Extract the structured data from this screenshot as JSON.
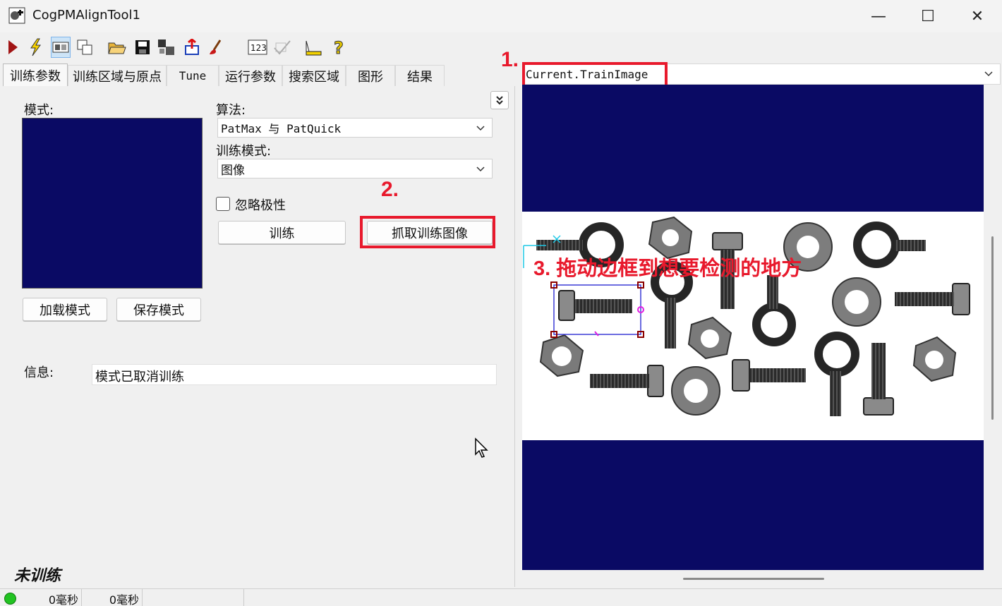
{
  "window": {
    "title": "CogPMAlignTool1"
  },
  "window_controls": {
    "minimize": "—",
    "maximize": "☐",
    "close": "✕"
  },
  "toolbar": {
    "items": [
      "run-icon",
      "lightning-icon",
      "display-icon",
      "copy-window-icon",
      "open-folder-icon",
      "save-icon",
      "settings-icon",
      "import-icon",
      "clear-icon",
      "number-display-icon",
      "check-disabled-icon",
      "measure-icon",
      "help-icon"
    ]
  },
  "tabs": [
    "训练参数",
    "训练区域与原点",
    "Tune",
    "运行参数",
    "搜索区域",
    "图形",
    "结果"
  ],
  "left": {
    "pattern_label": "模式:",
    "algorithm_label": "算法:",
    "algorithm_value": "PatMax 与 PatQuick",
    "train_mode_label": "训练模式:",
    "train_mode_value": "图像",
    "ignore_polarity_label": "忽略极性",
    "train_button": "训练",
    "grab_button": "抓取训练图像",
    "load_button": "加载模式",
    "save_button": "保存模式",
    "info_label": "信息:",
    "info_value": "模式已取消训练",
    "status_italic": "未训练"
  },
  "image_selector": {
    "value": "Current.TrainImage"
  },
  "annotations": {
    "step1": "1.",
    "step2": "2.",
    "step3": "3. 拖动边框到想要检测的地方"
  },
  "statusbar": {
    "time1": "0毫秒",
    "time2": "0毫秒"
  },
  "colors": {
    "accent_red": "#e8192c",
    "image_background": "#0a0a64",
    "status_green": "#22c322"
  }
}
